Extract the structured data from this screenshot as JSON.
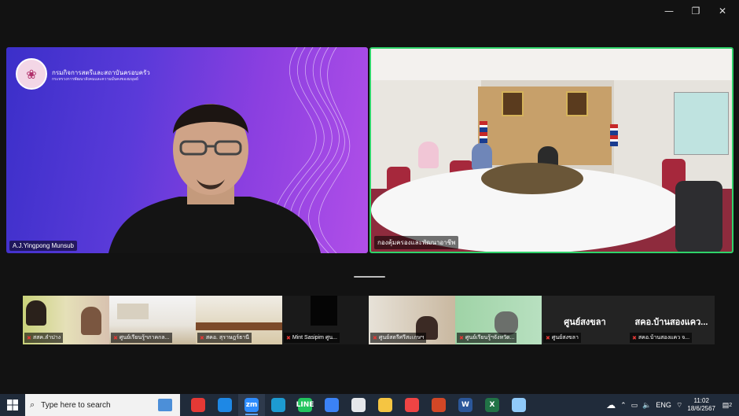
{
  "window": {
    "minimize_glyph": "—",
    "maximize_glyph": "❐",
    "close_glyph": "✕"
  },
  "main_tiles": [
    {
      "name": "A.J.Yingpong Munsub",
      "org_name": "กรมกิจการสตรีและสถาบันครอบครัว",
      "org_sub": "กระทรวงการพัฒนาสังคมและความมั่นคงของมนุษย์"
    },
    {
      "name": "กองคุ้มครองและพัฒนาอาชีพ",
      "active_speaker": true
    }
  ],
  "thumbnails": [
    {
      "name": "สสค.ลำปาง",
      "muted": true
    },
    {
      "name": "ศูนย์เรียนรู้ฯภาคกล...",
      "muted": true
    },
    {
      "name": "สคอ. สุราษฎร์ธานี",
      "muted": true
    },
    {
      "name": "Mint Sasipim ศูน...",
      "muted": true
    },
    {
      "name": "ศูนย์สตรีศรีสะเกษฯ",
      "muted": true
    },
    {
      "name": "ศูนย์เรียนรู้ฯจังหวัด...",
      "muted": true
    },
    {
      "name": "ศูนย์สงขลา",
      "muted": true,
      "video_off": true,
      "display": "ศูนย์สงขลา"
    },
    {
      "name": "สคอ.บ้านสองแคว จ...",
      "muted": true,
      "video_off": true,
      "display": "สคอ.บ้านสองแคว..."
    }
  ],
  "taskbar": {
    "search_placeholder": "Type here to search",
    "apps": [
      {
        "icon": "chrome-icon",
        "label": "",
        "color": "#e53935"
      },
      {
        "icon": "webex-icon",
        "label": "",
        "color": "#1e88e5"
      },
      {
        "icon": "zoom-icon",
        "label": "zm",
        "color": "#2d8cff",
        "active": true
      },
      {
        "icon": "edge-icon",
        "label": "",
        "color": "#1d9bd1"
      },
      {
        "icon": "line-icon",
        "label": "LINE",
        "color": "#22c55e"
      },
      {
        "icon": "mail-icon",
        "label": "",
        "color": "#3b82f6"
      },
      {
        "icon": "calendar-icon",
        "label": "",
        "color": "#e5e7eb"
      },
      {
        "icon": "file-explorer-icon",
        "label": "",
        "color": "#f5c542"
      },
      {
        "icon": "chrome-alt-icon",
        "label": "",
        "color": "#ef4444"
      },
      {
        "icon": "powerpoint-icon",
        "label": "",
        "color": "#d24726"
      },
      {
        "icon": "word-icon",
        "label": "W",
        "color": "#2b579a"
      },
      {
        "icon": "excel-icon",
        "label": "X",
        "color": "#217346"
      },
      {
        "icon": "notepad-icon",
        "label": "",
        "color": "#90caf9"
      }
    ],
    "language": "ENG",
    "time": "11:02",
    "date": "18/6/2567",
    "notification_count": "2"
  }
}
